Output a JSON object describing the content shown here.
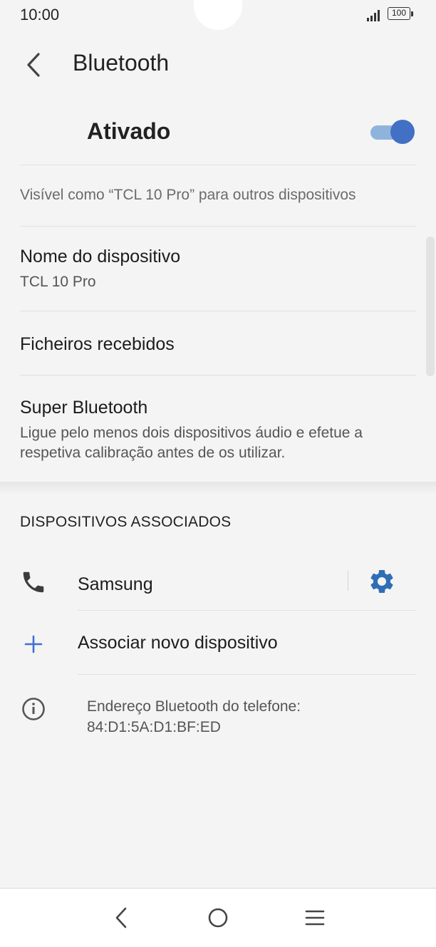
{
  "status_bar": {
    "time": "10:00",
    "battery": "100"
  },
  "header": {
    "title": "Bluetooth"
  },
  "bluetooth_toggle": {
    "label": "Ativado",
    "state": "on"
  },
  "visibility_text": "Visível como “TCL 10 Pro” para outros dispositivos",
  "device_name": {
    "title": "Nome do dispositivo",
    "value": "TCL 10 Pro"
  },
  "received_files": {
    "title": "Ficheiros recebidos"
  },
  "super_bluetooth": {
    "title": "Super Bluetooth",
    "line1": "Ligue pelo menos dois dispositivos áudio e efetue a",
    "line2": "respetiva calibração antes de os utilizar."
  },
  "paired_section": {
    "title": "DISPOSITIVOS ASSOCIADOS",
    "devices": [
      {
        "name": "Samsung",
        "icon": "phone-icon"
      }
    ]
  },
  "pair_new": {
    "label": "Associar novo dispositivo"
  },
  "address_info": {
    "line1": "Endereço Bluetooth do telefone:",
    "line2": "84:D1:5A:D1:BF:ED"
  },
  "colors": {
    "accent": "#4270c4",
    "toggle_track": "#8fb4dc",
    "settings_icon": "#2f6eb5",
    "plus": "#3f6fd1"
  }
}
